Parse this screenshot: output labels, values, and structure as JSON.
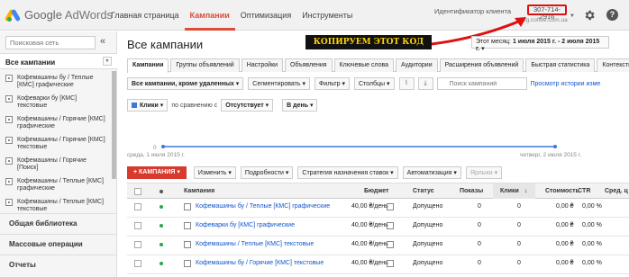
{
  "header": {
    "logo": {
      "brand": "Google",
      "product": "AdWords"
    },
    "nav": [
      "Главная страница",
      "Кампании",
      "Оптимизация",
      "Инструменты"
    ],
    "active_nav": 1,
    "client_label": "Идентификатор клиента",
    "client_id": "307-714-2916",
    "client_site": "3g.coffee.com.ua",
    "help_icon": "?"
  },
  "sidebar": {
    "search_placeholder": "Поисковая сеть",
    "collapse_icon": "«",
    "all_label": "Все кампании",
    "items": [
      "Кофемашины бу / Теплые [КМС] графические",
      "Кофеварки бу [КМС] текстовые",
      "Кофемашины / Горячие [КМС] графические",
      "Кофемашины / Горячие [КМС] текстовые",
      "Кофемашины / Горячие [Поиск]",
      "Кофемашины / Теплые [КМС] графические",
      "Кофемашины / Теплые [КМС] текстовые"
    ],
    "bottom_links": [
      "Общая библиотека",
      "Массовые операции",
      "Отчеты"
    ]
  },
  "main": {
    "title": "Все кампании",
    "annotation": "КОПИРУЕМ ЭТОТ КОД",
    "date_label": "Этот месяц:",
    "date_range": "1 июля 2015 г. - 2 июля 2015 г.",
    "tabs": [
      "Кампании",
      "Группы объявлений",
      "Настройки",
      "Объявления",
      "Ключевые слова",
      "Аудитории",
      "Расширения объявлений",
      "Быстрая статистика",
      "Контекстно-ме"
    ],
    "toolbar": {
      "filter_campaigns": "Все кампании, кроме удаленных",
      "segment": "Сегментировать",
      "filter": "Фильтр",
      "columns": "Столбцы",
      "search_placeholder": "Поиск кампаний",
      "history_link": "Просмотр истории изме"
    },
    "metrics": {
      "metric": "Клики",
      "compare_label": "по сравнению с",
      "compare_value": "Отсутствует",
      "period": "В день"
    },
    "chart_labels": {
      "left": "среда, 1 июля 2015 г.",
      "right": "четверг, 2 июля 2015 г.",
      "zero": "0"
    },
    "actions": {
      "new_campaign": "+ КАМПАНИЯ",
      "edit": "Изменить",
      "details": "Подробности",
      "bid_strategy": "Стратегия назначения ставок",
      "automation": "Автоматизация",
      "labels": "Ярлыки"
    },
    "table": {
      "headers": {
        "campaign": "Кампания",
        "budget": "Бюджет",
        "status": "Статус",
        "impressions": "Показы",
        "clicks": "Клики",
        "cost": "Стоимость",
        "ctr": "CTR",
        "avg": "Сред. ц"
      },
      "rows": [
        {
          "name": "Кофемашины бу / Теплые [КМС] графические",
          "budget": "40,00 ₴/день",
          "status": "Допущено",
          "impressions": "0",
          "clicks": "0",
          "cost": "0,00 ₴",
          "ctr": "0,00 %"
        },
        {
          "name": "Кофеварки бу [КМС] графические",
          "budget": "40,00 ₴/день",
          "status": "Допущено",
          "impressions": "0",
          "clicks": "0",
          "cost": "0,00 ₴",
          "ctr": "0,00 %"
        },
        {
          "name": "Кофемашины / Теплые [КМС] текстовые",
          "budget": "40,00 ₴/день",
          "status": "Допущено",
          "impressions": "0",
          "clicks": "0",
          "cost": "0,00 ₴",
          "ctr": "0,00 %"
        },
        {
          "name": "Кофемашины бу / Горячие [КМС] текстовые",
          "budget": "40,00 ₴/день",
          "status": "Допущено",
          "impressions": "0",
          "clicks": "0",
          "cost": "0,00 ₴",
          "ctr": "0,00 %"
        }
      ]
    }
  },
  "colors": {
    "accent": "#dd4b39",
    "link": "#1155cc",
    "chart_line": "#3d78d8",
    "annotation_bg": "#111111",
    "annotation_text": "#ffd400",
    "highlight_box": "#dd1111"
  }
}
